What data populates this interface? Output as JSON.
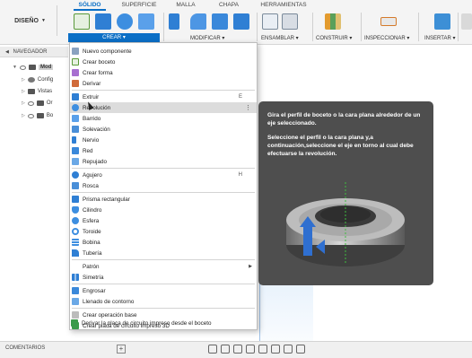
{
  "toolbar": {
    "design_button": "DISEÑO",
    "tabs": [
      "SÓLIDO",
      "SUPERFICIE",
      "MALLA",
      "CHAPA",
      "HERRAMIENTAS"
    ],
    "groups": {
      "crear": "CREAR",
      "modificar": "MODIFICAR",
      "ensamblar": "ENSAMBLAR",
      "construir": "CONSTRUIR",
      "inspeccionar": "INSPECCIONAR",
      "insertar": "INSERTAR"
    }
  },
  "browser": {
    "header": "NAVEGADOR",
    "rows": [
      "Mod",
      "Config",
      "Vistas",
      "Or",
      "Bo"
    ]
  },
  "bottom": {
    "comments": "COMENTARIOS"
  },
  "menu": {
    "items": [
      {
        "label": "Nuevo componente"
      },
      {
        "label": "Crear boceto"
      },
      {
        "label": "Crear forma"
      },
      {
        "label": "Derivar"
      },
      {
        "label": "Extruir",
        "shortcut": "E"
      },
      {
        "label": "Revolución"
      },
      {
        "label": "Barrido"
      },
      {
        "label": "Solevación"
      },
      {
        "label": "Nervio"
      },
      {
        "label": "Red"
      },
      {
        "label": "Repujado"
      },
      {
        "label": "Agujero",
        "shortcut": "H"
      },
      {
        "label": "Rosca"
      },
      {
        "label": "Prisma rectangular"
      },
      {
        "label": "Cilindro"
      },
      {
        "label": "Esfera"
      },
      {
        "label": "Toroide"
      },
      {
        "label": "Bobina"
      },
      {
        "label": "Tubería"
      },
      {
        "label": "Patrón"
      },
      {
        "label": "Simetría"
      },
      {
        "label": "Engrosar"
      },
      {
        "label": "Llenado de contorno"
      },
      {
        "label": "Crear operación base"
      },
      {
        "label": "Crear placa de circuito impreso 3D"
      },
      {
        "label": "Derivar la placa de circuito impreso desde el boceto"
      }
    ]
  },
  "tooltip": {
    "text1": "Gira el perfil de boceto o la cara plana alrededor de un eje seleccionado.",
    "text2": "Seleccione el perfil o la cara plana y,a continuación,seleccione el eje en torno al cual debe efectuarse la revolución."
  },
  "colors": {
    "accent": "#0b6fc6",
    "tooltip_bg": "#4e4e4e",
    "menu_highlight": "#dcdcdc"
  },
  "icons": [
    "create-sketch-icon",
    "extrude-icon",
    "revolve-icon",
    "press-pull-icon",
    "fillet-icon",
    "new-component-icon",
    "joint-icon",
    "midplane-icon",
    "measure-icon",
    "insert-image-icon"
  ]
}
